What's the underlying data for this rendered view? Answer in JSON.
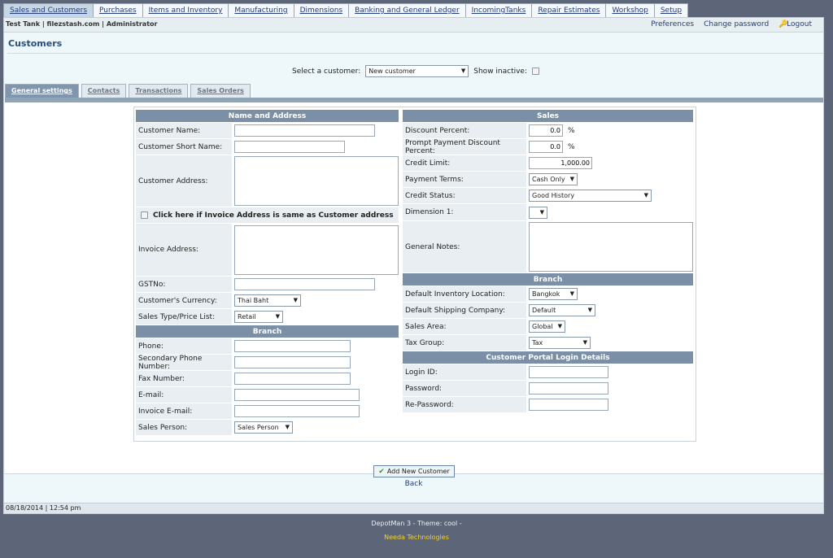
{
  "top_tabs": [
    "Sales and Customers",
    "Purchases",
    "Items and Inventory",
    "Manufacturing",
    "Dimensions",
    "Banking and General Ledger",
    "IncomingTanks",
    "Repair Estimates",
    "Workshop",
    "Setup"
  ],
  "userbar": {
    "who": "Test Tank | filezstash.com | Administrator",
    "preferences": "Preferences",
    "change_password": "Change password",
    "logout": "Logout"
  },
  "page_title": "Customers",
  "selector": {
    "label": "Select a customer:",
    "value": "New customer",
    "show_inactive": "Show inactive:"
  },
  "sub_tabs": [
    "General settings",
    "Contacts",
    "Transactions",
    "Sales Orders"
  ],
  "left": {
    "name_address_header": "Name and Address",
    "customer_name": "Customer Name:",
    "customer_short_name": "Customer Short Name:",
    "customer_address": "Customer Address:",
    "same_address": "Click here if Invoice Address is same as Customer address",
    "invoice_address": "Invoice Address:",
    "gstno": "GSTNo:",
    "currency_label": "Customer's Currency:",
    "currency_value": "Thai Baht",
    "sales_type_label": "Sales Type/Price List:",
    "sales_type_value": "Retail",
    "branch_header": "Branch",
    "phone": "Phone:",
    "secondary_phone": "Secondary Phone Number:",
    "fax": "Fax Number:",
    "email": "E-mail:",
    "invoice_email": "Invoice E-mail:",
    "sales_person_label": "Sales Person:",
    "sales_person_value": "Sales Person"
  },
  "right": {
    "sales_header": "Sales",
    "discount_label": "Discount Percent:",
    "discount_value": "0.0",
    "prompt_label": "Prompt Payment Discount Percent:",
    "prompt_value": "0.0",
    "percent_sign": "%",
    "credit_limit_label": "Credit Limit:",
    "credit_limit_value": "1,000.00",
    "payment_terms_label": "Payment Terms:",
    "payment_terms_value": "Cash Only",
    "credit_status_label": "Credit Status:",
    "credit_status_value": "Good History",
    "dimension_label": "Dimension 1:",
    "dimension_value": "",
    "general_notes": "General Notes:",
    "branch_header": "Branch",
    "inv_location_label": "Default Inventory Location:",
    "inv_location_value": "Bangkok",
    "shipping_label": "Default Shipping Company:",
    "shipping_value": "Default",
    "sales_area_label": "Sales Area:",
    "sales_area_value": "Global",
    "tax_group_label": "Tax Group:",
    "tax_group_value": "Tax",
    "portal_header": "Customer Portal Login Details",
    "login_id": "Login ID:",
    "password": "Password:",
    "re_password": "Re-Password:"
  },
  "add_button": "Add New Customer",
  "back": "Back",
  "status": "08/18/2014 | 12:54 pm",
  "footer_line1": "DepotMan 3 - Theme: cool -",
  "footer_line2": "Needa Technologies",
  "icons": {
    "dropdown": "▼",
    "key": "key-icon",
    "check": "check-icon"
  }
}
